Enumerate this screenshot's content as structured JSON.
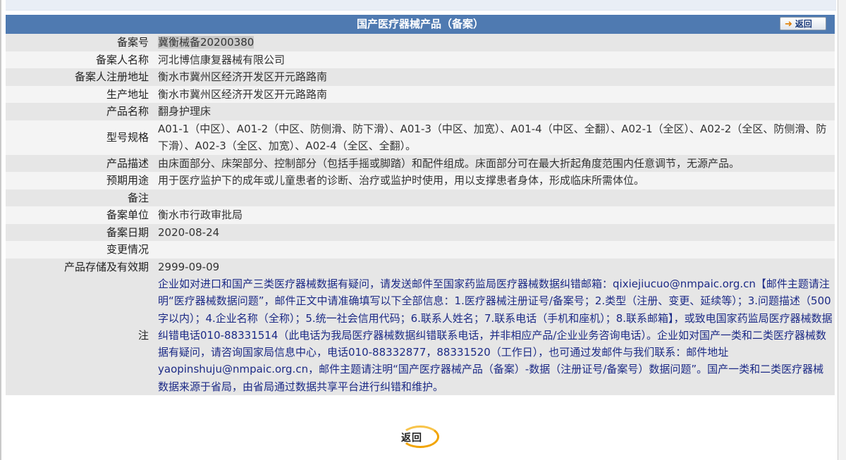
{
  "page": {
    "title": "国产医疗器械产品（备案）",
    "back_top_label": "返回",
    "back_bottom_label": "返回"
  },
  "rows": [
    {
      "label": "备案号",
      "value": "冀衡械备20200380"
    },
    {
      "label": "备案人名称",
      "value": "河北博信康复器械有限公司"
    },
    {
      "label": "备案人注册地址",
      "value": "衡水市冀州区经济开发区开元路路南"
    },
    {
      "label": "生产地址",
      "value": "衡水市冀州区经济开发区开元路路南"
    },
    {
      "label": "产品名称",
      "value": "翻身护理床"
    },
    {
      "label": "型号规格",
      "value": "A01-1（中区）、A01-2（中区、防侧滑、防下滑）、A01-3（中区、加宽）、A01-4（中区、全翻）、A02-1（全区）、A02-2（全区、防侧滑、防下滑）、A02-3（全区、加宽）、A02-4（全区、全翻）。"
    },
    {
      "label": "产品描述",
      "value": "由床面部分、床架部分、控制部分（包括手摇或脚踏）和配件组成。床面部分可在最大折起角度范围内任意调节，无源产品。"
    },
    {
      "label": "预期用途",
      "value": "用于医疗监护下的成年或儿童患者的诊断、治疗或监护时使用，用以支撑患者身体，形成临床所需体位。"
    },
    {
      "label": "备注",
      "value": ""
    },
    {
      "label": "备案单位",
      "value": "衡水市行政审批局"
    },
    {
      "label": "备案日期",
      "value": "2020-08-24"
    },
    {
      "label": "变更情况",
      "value": ""
    },
    {
      "label": "产品存储及有效期",
      "value": "2999-09-09"
    }
  ],
  "note": {
    "label": "注",
    "text": "企业如对进口和国产三类医疗器械数据有疑问，请发送邮件至国家药监局医疗器械数据纠错邮箱：qixiejiucuo@nmpaic.org.cn【邮件主题请注明“医疗器械数据问题”，邮件正文中请准确填写以下全部信息：1.医疗器械注册证号/备案号；2.类型（注册、变更、延续等）；3.问题描述（500字以内）；4.企业名称（全称）；5.统一社会信用代码；6.联系人姓名；7.联系电话（手机和座机）；8.联系邮箱】，或致电国家药监局医疗器械数据纠错电话010-88331514（此电话为我局医疗器械数据纠错联系电话，并非相应产品/企业业务咨询电话）。企业如对国产一类和二类医疗器械数据有疑问，请咨询国家局信息中心，电话010-88332877，88331520（工作日），也可通过发邮件与我们联系：邮件地址yaopinshuju@nmpaic.org.cn，邮件主题请注明“国产医疗器械产品（备案）-数据（注册证号/备案号）数据问题”。国产一类和二类医疗器械数据来源于省局，由省局通过数据共享平台进行纠错和维护。"
  },
  "colors": {
    "header_bg": "#4f7ab1",
    "row_odd": "#e6e6e6",
    "row_even": "#f4f4f4",
    "note_text": "#1c2a86",
    "back_ring": "#f2a400"
  }
}
